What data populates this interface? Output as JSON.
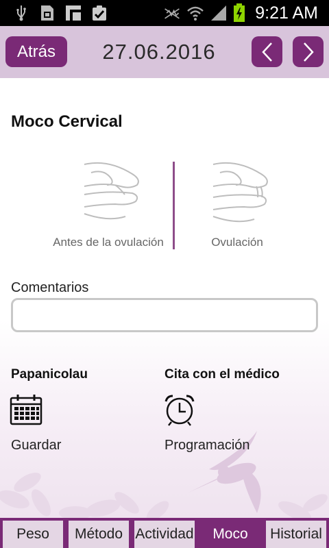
{
  "status_bar": {
    "time": "9:21 AM",
    "icons": [
      "usb-icon",
      "sim-card-icon",
      "notification-icon",
      "clipboard-check-icon",
      "mute-icon",
      "wifi-icon",
      "signal-icon",
      "battery-charging-icon"
    ]
  },
  "header": {
    "back_label": "Atrás",
    "date": "27.06.2016",
    "prev_icon": "chevron-left-icon",
    "next_icon": "chevron-right-icon"
  },
  "mucus": {
    "title": "Moco Cervical",
    "options": [
      {
        "label": "Antes de la ovulación",
        "icon": "fingers-dry-icon"
      },
      {
        "label": "Ovulación",
        "icon": "fingers-stretchy-icon"
      }
    ]
  },
  "comments": {
    "label": "Comentarios",
    "value": "",
    "placeholder": ""
  },
  "pap": {
    "title": "Papanicolau",
    "icon": "calendar-icon",
    "action": "Guardar"
  },
  "appointment": {
    "title": "Cita con el médico",
    "icon": "alarm-clock-icon",
    "action": "Programación"
  },
  "tabs": [
    {
      "label": "Peso",
      "active": false
    },
    {
      "label": "Método",
      "active": false
    },
    {
      "label": "Actividad",
      "active": false
    },
    {
      "label": "Moco",
      "active": true
    },
    {
      "label": "Historial",
      "active": false
    }
  ],
  "colors": {
    "accent": "#7a2a76",
    "header_bg": "#d8c4db",
    "tab_inactive": "#e4d6e4"
  }
}
